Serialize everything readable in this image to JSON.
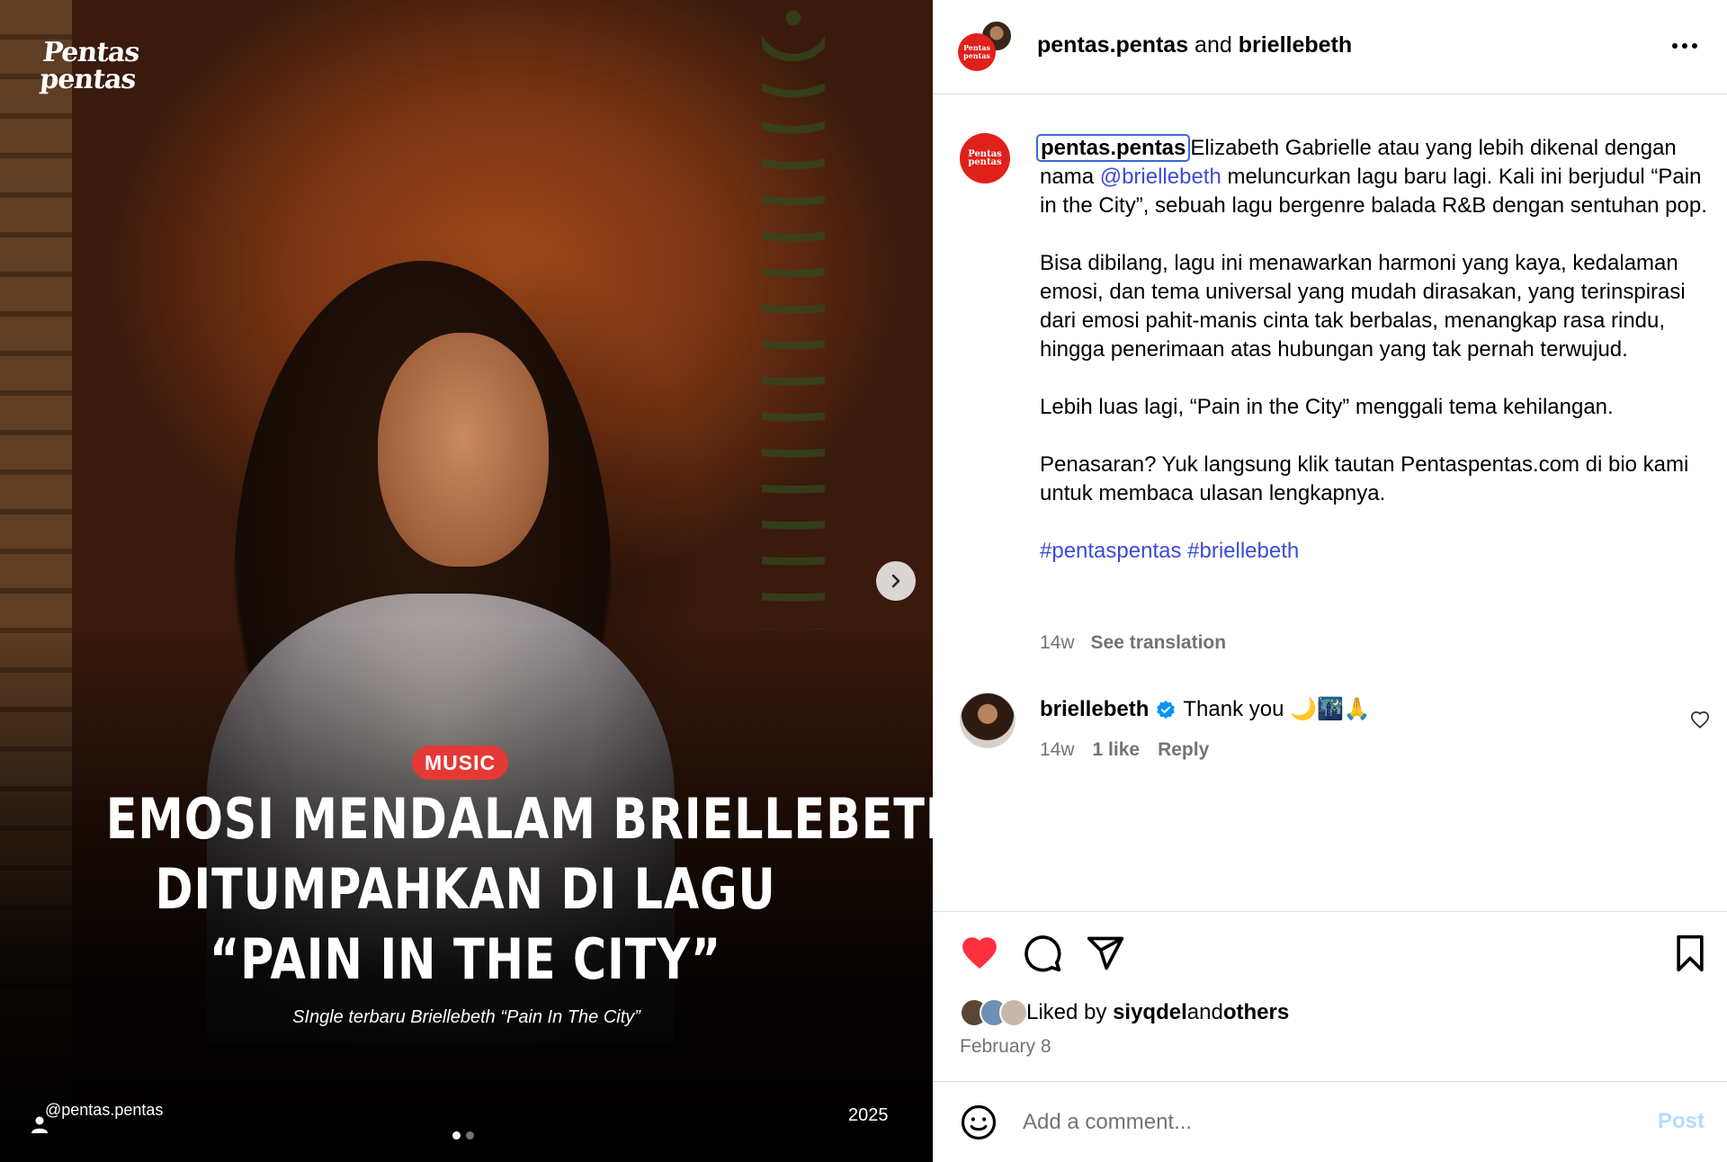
{
  "media": {
    "brand_line1": "Pentas",
    "brand_line2": "pentas",
    "category": "MUSIC",
    "headline_lines": [
      "EMOSI MENDALAM BRIELLEBETH",
      "DITUMPAHKAN DI LAGU",
      "“PAIN IN THE CITY”"
    ],
    "subtitle": "SIngle terbaru Briellebeth “Pain In The City”",
    "footer_handle": "@pentas.pentas",
    "footer_year": "2025",
    "carousel_index": 1,
    "carousel_count": 2
  },
  "header": {
    "user1": "pentas.pentas",
    "joiner": " and ",
    "user2": "briellebeth",
    "avatar_text": "Pentas pentas"
  },
  "caption": {
    "username": "pentas.pentas",
    "p1_a": "Elizabeth Gabrielle atau yang lebih dikenal dengan nama ",
    "p1_mention": "@briellebeth",
    "p1_b": " meluncurkan lagu baru lagi. Kali ini berjudul “Pain in the City”, sebuah lagu bergenre balada R&B dengan sentuhan pop.",
    "p2": "Bisa dibilang, lagu ini menawarkan harmoni yang kaya, kedalaman emosi, dan tema universal yang mudah dirasakan, yang terinspirasi dari emosi pahit-manis cinta tak berbalas, menangkap rasa rindu, hingga penerimaan atas hubungan yang tak pernah terwujud.",
    "p3": "Lebih luas lagi, “Pain in the City” menggali tema kehilangan.",
    "p4": "Penasaran? Yuk langsung klik tautan Pentaspentas.com di bio kami untuk membaca ulasan lengkapnya.",
    "hashtag1": "#pentaspentas",
    "hashtag2": "#briellebeth",
    "age": "14w",
    "see_translation": "See translation"
  },
  "comment": {
    "username": "briellebeth",
    "text": "Thank you 🌙🌃🙏",
    "age": "14w",
    "likes": "1 like",
    "reply": "Reply"
  },
  "actions": {
    "liked": true,
    "liked_prefix": "Liked by ",
    "liked_user": "siyqdel",
    "liked_and": " and ",
    "liked_others": "others",
    "date": "February 8",
    "like_color": "#ff3040"
  },
  "comment_box": {
    "placeholder": "Add a comment...",
    "post_label": "Post"
  },
  "colors": {
    "link": "#3b4bd8",
    "brand_red": "#e0201b",
    "badge_red": "#e53935",
    "verified": "#0095f6"
  }
}
